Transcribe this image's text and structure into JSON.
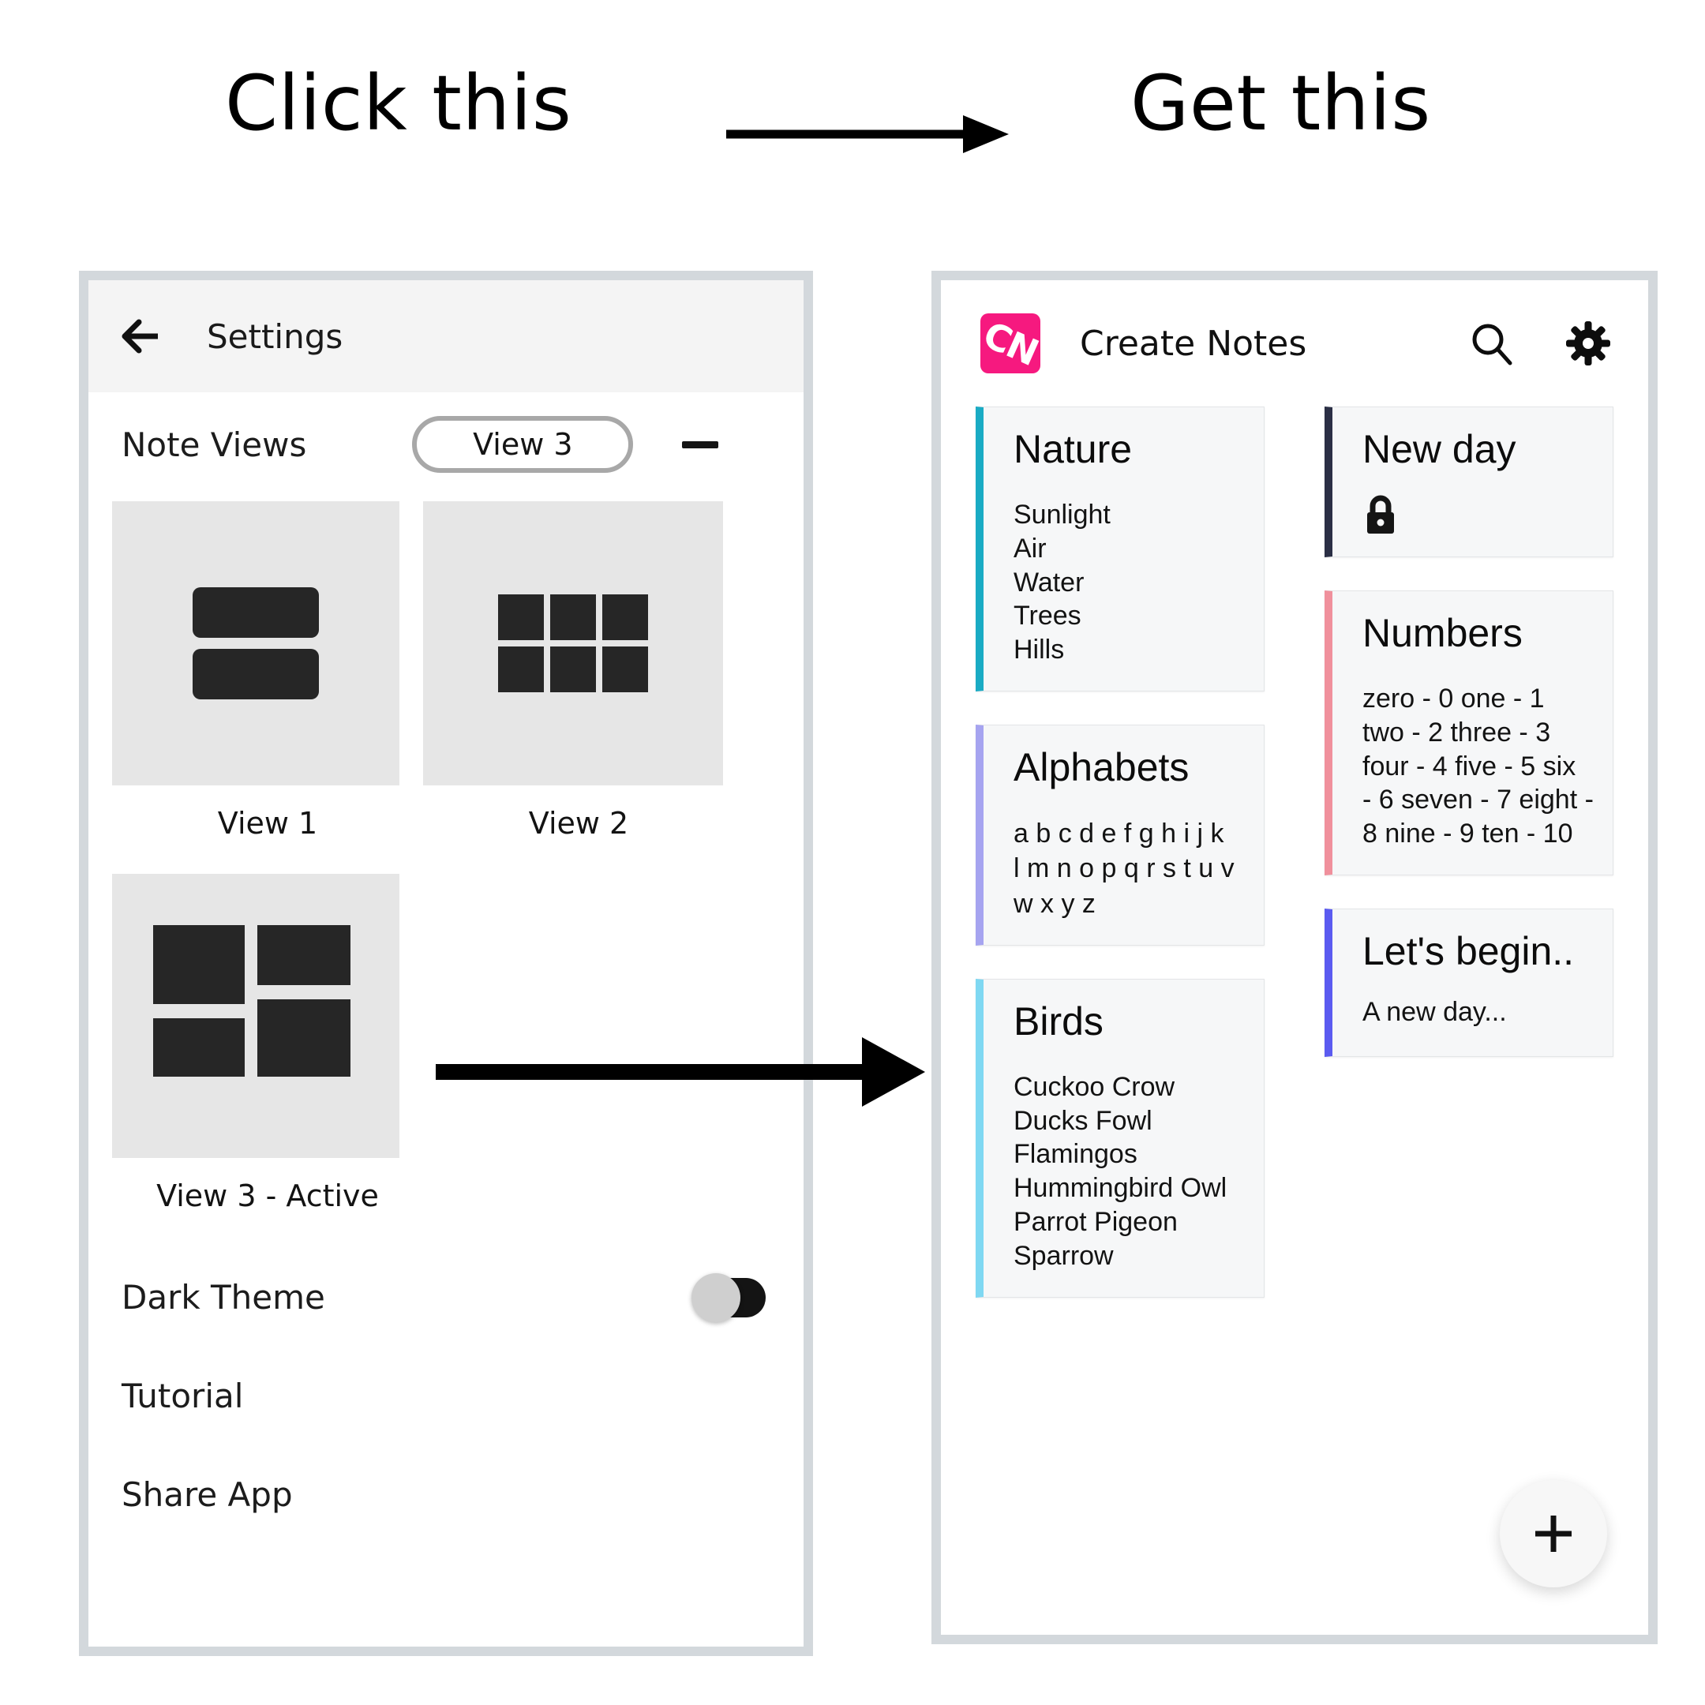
{
  "annotations": {
    "left_label": "Click this",
    "right_label": "Get this",
    "arrow_top_name": "right-arrow",
    "arrow_mid_name": "right-arrow"
  },
  "settings_screen": {
    "appbar": {
      "back_icon": "back-arrow-icon",
      "title": "Settings"
    },
    "note_views": {
      "label": "Note Views",
      "selected_value": "View 3",
      "collapse_icon": "minus-icon",
      "options": [
        {
          "caption": "View 1",
          "glyph": "two-rows-icon"
        },
        {
          "caption": "View 2",
          "glyph": "grid-six-icon"
        },
        {
          "caption": "View 3 - Active",
          "glyph": "staggered-mosaic-icon"
        }
      ]
    },
    "rows": [
      {
        "label": "Dark Theme",
        "control": "toggle",
        "state": "off"
      },
      {
        "label": "Tutorial",
        "control": "none"
      },
      {
        "label": "Share App",
        "control": "none"
      }
    ]
  },
  "notes_screen": {
    "appbar": {
      "logo_text": "CN",
      "logo_color": "#f6197f",
      "title": "Create Notes",
      "search_icon": "search-icon",
      "settings_icon": "gear-icon"
    },
    "left_column": [
      {
        "title": "Nature",
        "body": "Sunlight\nAir\nWater\nTrees\nHills",
        "accent": "#1aabc4",
        "locked": false
      },
      {
        "title": "Alphabets",
        "body": "a b c d e f g h i j k\nl m n o p q r s t u v\nw x y z",
        "accent": "#a6a4f0",
        "locked": false
      },
      {
        "title": "Birds",
        "body": "Cuckoo Crow\nDucks Fowl\nFlamingos\nHummingbird Owl\nParrot Pigeon\nSparrow",
        "accent": "#7fd8f2",
        "locked": false
      }
    ],
    "right_column": [
      {
        "title": "New day",
        "body": "",
        "accent": "#2b2f45",
        "locked": true,
        "lock_icon": "lock-icon"
      },
      {
        "title": "Numbers",
        "body": "zero - 0 one - 1\ntwo - 2 three - 3\nfour - 4 five - 5 six\n- 6 seven - 7 eight -\n8 nine - 9 ten - 10",
        "accent": "#f0909c",
        "locked": false
      },
      {
        "title": "Let's begin..",
        "body": "A new day...",
        "accent": "#5b5bf0",
        "locked": false
      }
    ],
    "fab": {
      "icon": "plus-icon",
      "label": "+"
    }
  }
}
